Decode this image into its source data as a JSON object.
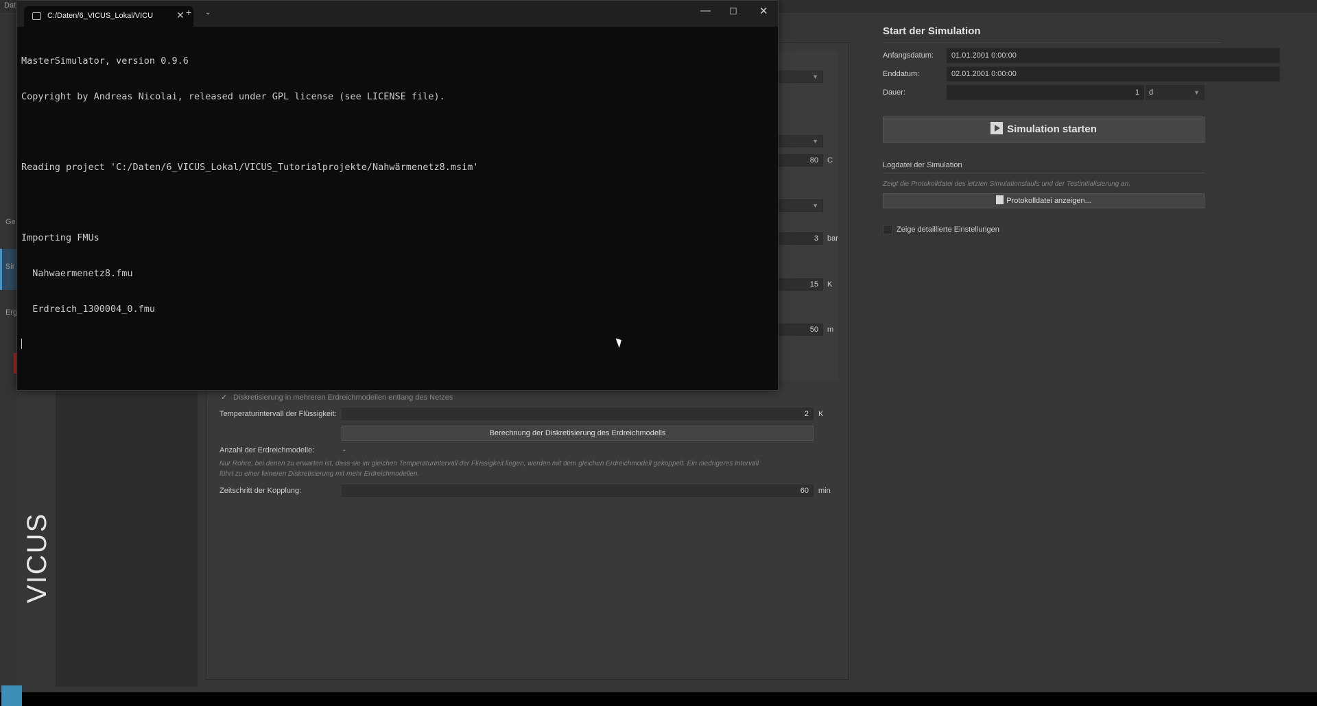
{
  "menubar": {
    "first_item": "Dat"
  },
  "left_rail": {
    "labels": [
      "Ge",
      "Sir",
      "Erg"
    ],
    "logo_text": "VICUS"
  },
  "network_settings": {
    "temperature": {
      "value": "80",
      "unit": "C"
    },
    "pressure": {
      "value": "3",
      "unit": "bar"
    },
    "temp_difference": {
      "value": "15",
      "unit": "K"
    },
    "length": {
      "value": "50",
      "unit": "m"
    },
    "discretization_checkbox_label": "Diskretisierung in mehreren Erdreichmodellen entlang des Netzes",
    "fluid_temp_interval_label": "Temperaturintervall der Flüssigkeit:",
    "fluid_temp_interval_value": "2",
    "fluid_temp_interval_unit": "K",
    "compute_button": "Berechnung der Diskretisierung des Erdreichmodells",
    "soil_model_count_label": "Anzahl der Erdreichmodelle:",
    "soil_model_count_value": "-",
    "hint_line1": "Nur Rohre, bei denen zu erwarten ist, dass sie im gleichen Temperaturintervall der Flüssigkeit liegen, werden mit dem gleichen Erdreichmodell gekoppelt. Ein niedrigeres Intervall",
    "hint_line2": "führt zu einer feineren Diskretisierung mit mehr Erdreichmodellen.",
    "coupling_step_label": "Zeitschritt der Kopplung:",
    "coupling_step_value": "60",
    "coupling_step_unit": "min"
  },
  "simulation": {
    "title": "Start der Simulation",
    "start_label": "Anfangsdatum:",
    "start_value": "01.01.2001  0:00:00",
    "end_label": "Enddatum:",
    "end_value": "02.01.2001  0:00:00",
    "duration_label": "Dauer:",
    "duration_value": "1",
    "duration_unit": "d",
    "start_button": "Simulation starten",
    "log_title": "Logdatei der Simulation",
    "log_hint": "Zeigt die Protokolldatei des letzten Simulationslaufs und der Testinitialisierung an.",
    "log_button": "Protokolldatei anzeigen...",
    "details_checkbox": "Zeige detaillierte Einstellungen"
  },
  "terminal": {
    "tab_title": "C:/Daten/6_VICUS_Lokal/VICU",
    "lines": [
      "MasterSimulator, version 0.9.6",
      "Copyright by Andreas Nicolai, released under GPL license (see LICENSE file).",
      "",
      "Reading project 'C:/Daten/6_VICUS_Lokal/VICUS_Tutorialprojekte/Nahwärmenetz8.msim'",
      "",
      "Importing FMUs",
      "  Nahwaermenetz8.fmu",
      "  Erdreich_1300004_0.fmu"
    ]
  }
}
